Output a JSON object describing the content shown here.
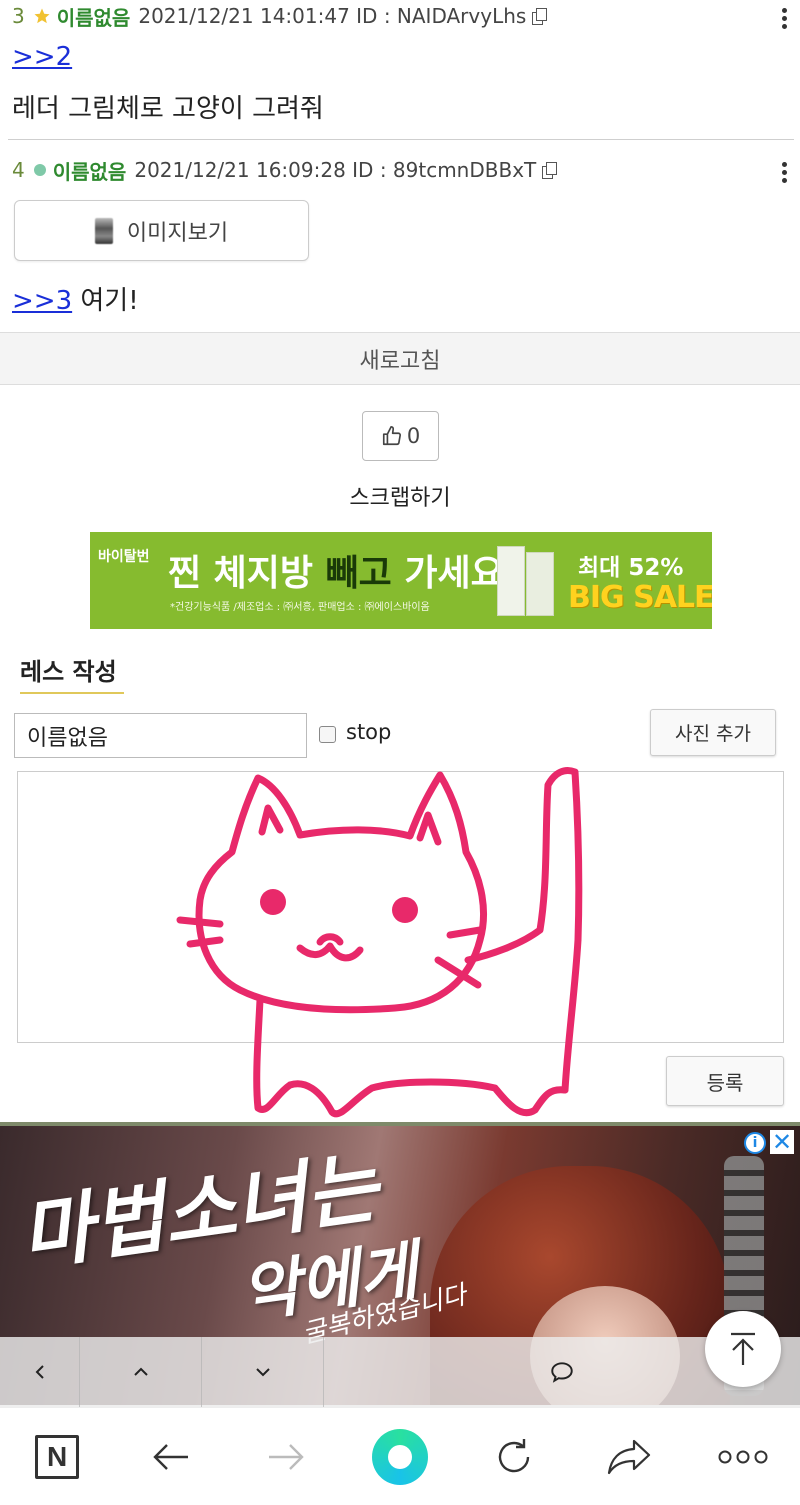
{
  "posts": [
    {
      "num": "3",
      "name": "이름없음",
      "meta": "2021/12/21 14:01:47 ID : NAIDArvyLhs",
      "reply": ">>2",
      "text": "레더 그림체로 고양이 그려줘",
      "marker": "star-icon",
      "marker_color": "#f1c232"
    },
    {
      "num": "4",
      "name": "이름없음",
      "meta": "2021/12/21 16:09:28 ID : 89tcmnDBBxT",
      "image_button": "이미지보기",
      "reply": ">>3",
      "text": "여기!",
      "marker": "dot-icon",
      "marker_color": "#7fc9a8"
    }
  ],
  "refresh_label": "새로고침",
  "like_count": "0",
  "scrap_label": "스크랩하기",
  "banner1": {
    "brand": "바이탈번",
    "headline_a": "찐 체지방 ",
    "headline_b": "빼고 ",
    "headline_c": "가세요!",
    "small": "*건강기능식품 /제조업소 : ㈜서흥, 판매업소 : ㈜에이스바이옴",
    "sale_top": "최대 52%",
    "sale_big": "BIG SALE"
  },
  "reply_form": {
    "section_title": "레스 작성",
    "name_value": "이름없음",
    "stop_label": "stop",
    "photo_button": "사진 추가",
    "submit_button": "등록"
  },
  "ad2": {
    "title_line1": "마법소녀는",
    "title_line2": "악에게",
    "sub": "굴복하였습니다"
  },
  "colors": {
    "name_green": "#2f8a2f",
    "link_blue": "#1a2fd8",
    "drawing_pink": "#e8296a",
    "banner_green": "#86bb2f"
  }
}
